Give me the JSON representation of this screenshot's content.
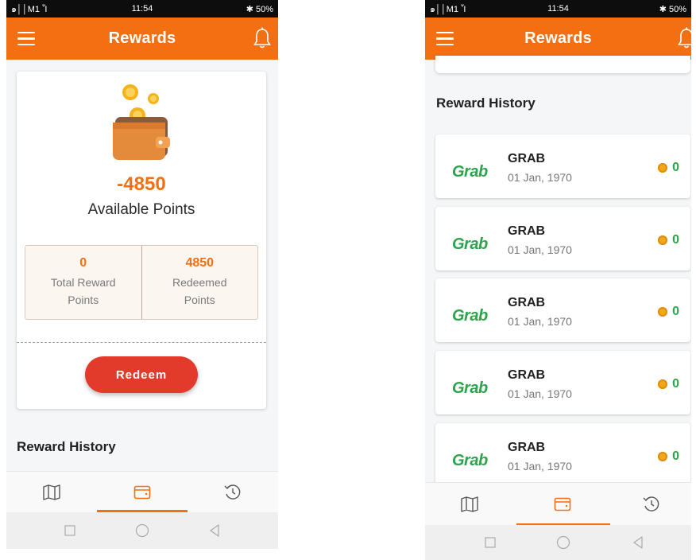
{
  "status_bar": {
    "carrier": "๑││M1 Ἷ",
    "time": "11:54",
    "battery": "✱ 50%"
  },
  "app_bar": {
    "title": "Rewards"
  },
  "summary": {
    "points": "-4850",
    "points_label": "Available Points",
    "total_reward_value": "0",
    "total_reward_label": "Total Reward\nPoints",
    "redeemed_value": "4850",
    "redeemed_label": "Redeemed\nPoints",
    "redeem_button": "Redeem"
  },
  "history_title": "Reward History",
  "history": [
    {
      "logo": "Grab",
      "name": "GRAB",
      "date": "01 Jan, 1970",
      "points": "0"
    },
    {
      "logo": "Grab",
      "name": "GRAB",
      "date": "01 Jan, 1970",
      "points": "0"
    },
    {
      "logo": "Grab",
      "name": "GRAB",
      "date": "01 Jan, 1970",
      "points": "0"
    },
    {
      "logo": "Grab",
      "name": "GRAB",
      "date": "01 Jan, 1970",
      "points": "0"
    },
    {
      "logo": "Grab",
      "name": "GRAB",
      "date": "01 Jan, 1970",
      "points": "0"
    }
  ],
  "bottom_nav": [
    "map-icon",
    "wallet-icon",
    "history-icon"
  ],
  "active_tab": "wallet-icon",
  "colors": {
    "accent": "#f36f12",
    "redeem": "#e23b2c",
    "grab_green": "#2fa34d"
  }
}
